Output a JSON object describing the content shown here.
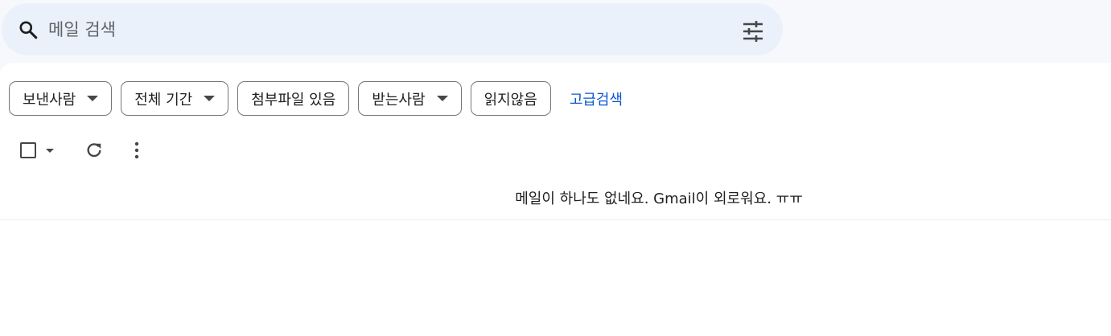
{
  "search": {
    "placeholder": "메일 검색",
    "value": ""
  },
  "filters": {
    "chips": [
      {
        "label": "보낸사람",
        "has_dropdown": true
      },
      {
        "label": "전체 기간",
        "has_dropdown": true
      },
      {
        "label": "첨부파일 있음",
        "has_dropdown": false
      },
      {
        "label": "받는사람",
        "has_dropdown": true
      },
      {
        "label": "읽지않음",
        "has_dropdown": false
      }
    ],
    "advanced_search_label": "고급검색"
  },
  "toolbar": {
    "icons": [
      "checkbox-icon",
      "caret-down-icon",
      "refresh-icon",
      "more-vert-icon"
    ]
  },
  "inbox": {
    "empty_message": "메일이 하나도 없네요. Gmail이 외로워요. ㅠㅠ"
  },
  "colors": {
    "page_bg": "#f6f8fc",
    "search_bg": "#eaf1fb",
    "link": "#0b57d0",
    "chip_border": "#747775"
  }
}
